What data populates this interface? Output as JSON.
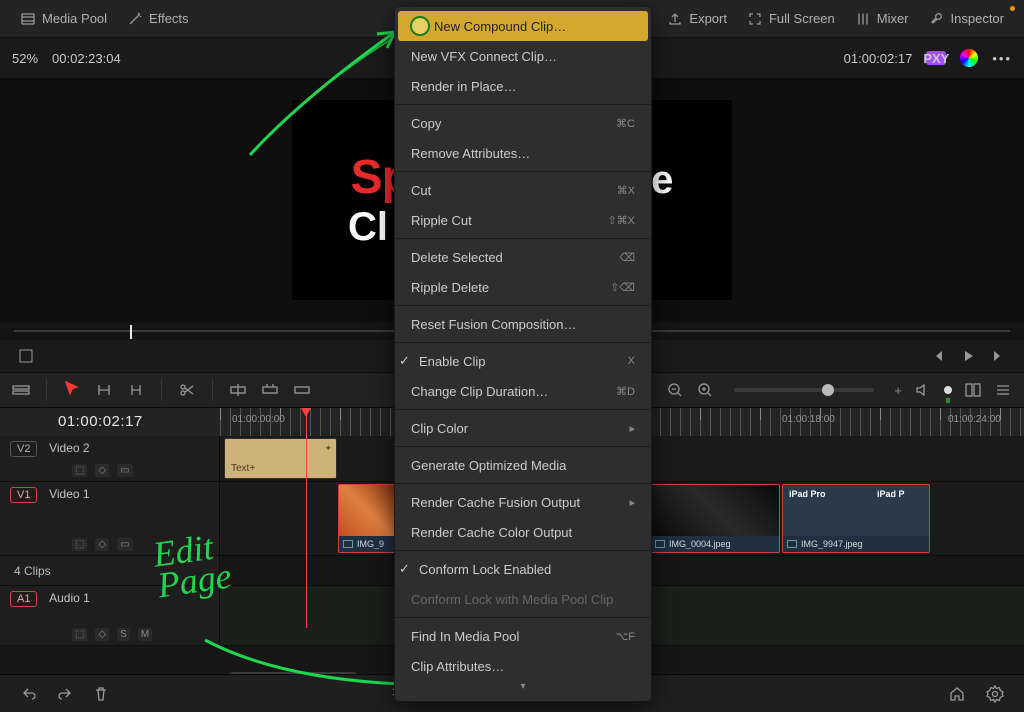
{
  "topbar": {
    "media_pool": "Media Pool",
    "effects": "Effects",
    "export": "Export",
    "full_screen": "Full Screen",
    "mixer": "Mixer",
    "inspector": "Inspector"
  },
  "secbar": {
    "zoom": "52%",
    "left_tc": "00:02:23:04",
    "right_tc": "01:00:02:17",
    "pill": "PXY"
  },
  "viewer": {
    "line1_visible": "Spe",
    "line1_hidden_right": "ple",
    "line2_visible": "Cl"
  },
  "timeline": {
    "master_tc": "01:00:02:17",
    "ruler_tc": [
      "01:00:00:00",
      "01:00:18:00",
      "01:00:24:00"
    ],
    "clips_count": "4 Clips"
  },
  "tracks": {
    "v2": {
      "num": "V2",
      "name": "Video 2"
    },
    "v1": {
      "num": "V1",
      "name": "Video 1"
    },
    "a1": {
      "num": "A1",
      "name": "Audio 1"
    },
    "icons": {
      "lock": "🔒",
      "auto": "◇",
      "toggle": "▭",
      "s": "S",
      "m": "M"
    }
  },
  "clips": {
    "text_label": "Text+",
    "img1": "IMG_9",
    "img2": "IMG_0004.jpeg",
    "img3": "IMG_9947.jpeg"
  },
  "context_menu": {
    "items": [
      {
        "label": "New Compound Clip…",
        "highlight": true
      },
      {
        "label": "New VFX Connect Clip…"
      },
      {
        "label": "Render in Place…"
      },
      {
        "sep": true
      },
      {
        "label": "Copy",
        "shortcut": "⌘C"
      },
      {
        "label": "Remove Attributes…"
      },
      {
        "sep": true
      },
      {
        "label": "Cut",
        "shortcut": "⌘X"
      },
      {
        "label": "Ripple Cut",
        "shortcut": "⇧⌘X"
      },
      {
        "sep": true
      },
      {
        "label": "Delete Selected",
        "shortcut": "⌫"
      },
      {
        "label": "Ripple Delete",
        "shortcut": "⇧⌫"
      },
      {
        "sep": true
      },
      {
        "label": "Reset Fusion Composition…"
      },
      {
        "sep": true
      },
      {
        "label": "Enable Clip",
        "shortcut": "X",
        "checked": true
      },
      {
        "label": "Change Clip Duration…",
        "shortcut": "⌘D"
      },
      {
        "sep": true
      },
      {
        "label": "Clip Color",
        "submenu": true
      },
      {
        "sep": true
      },
      {
        "label": "Generate Optimized Media"
      },
      {
        "sep": true
      },
      {
        "label": "Render Cache Fusion Output",
        "submenu": true
      },
      {
        "label": "Render Cache Color Output"
      },
      {
        "sep": true
      },
      {
        "label": "Conform Lock Enabled",
        "checked": true
      },
      {
        "label": "Conform Lock with Media Pool Clip",
        "disabled": true
      },
      {
        "sep": true
      },
      {
        "label": "Find In Media Pool",
        "shortcut": "⌥F"
      },
      {
        "label": "Clip Attributes…"
      }
    ]
  },
  "annotations": {
    "edit_page": "Edit\nPage"
  }
}
